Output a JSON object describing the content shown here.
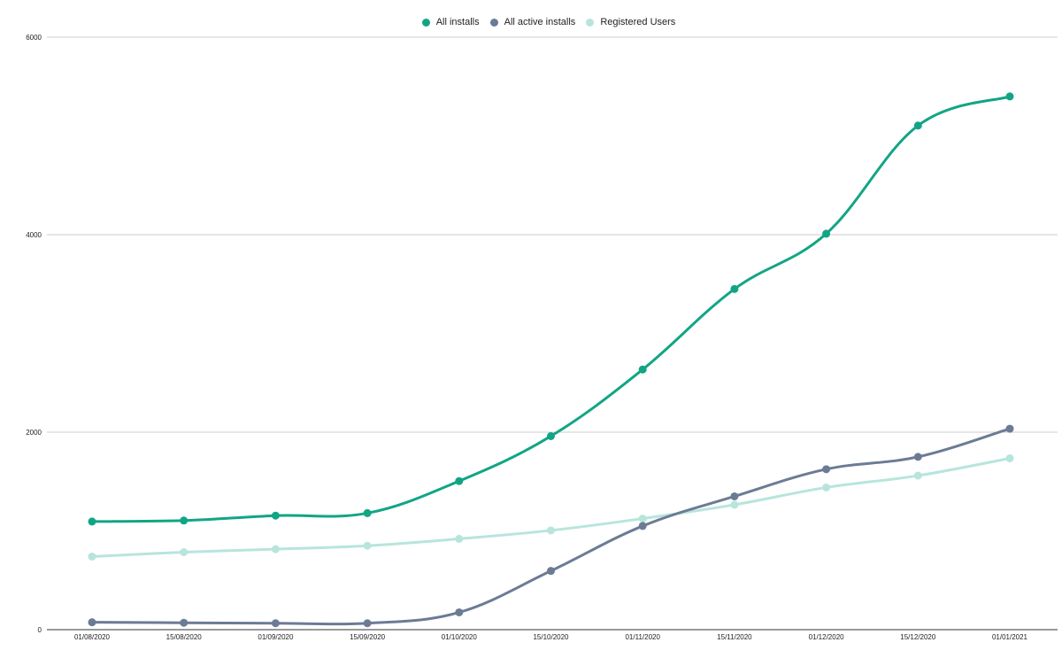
{
  "chart_data": {
    "type": "line",
    "title": "",
    "xlabel": "",
    "ylabel": "",
    "categories": [
      "01/08/2020",
      "15/08/2020",
      "01/09/2020",
      "15/09/2020",
      "01/10/2020",
      "15/10/2020",
      "01/11/2020",
      "15/11/2020",
      "01/12/2020",
      "15/12/2020",
      "01/01/2021"
    ],
    "yticks": [
      "0",
      "2000",
      "4000",
      "6000"
    ],
    "ylim": [
      0,
      6000
    ],
    "grid": true,
    "legend_position": "top-center",
    "series": [
      {
        "name": "All installs",
        "color": "#12a585",
        "values": [
          1095,
          1105,
          1155,
          1180,
          1505,
          1960,
          2635,
          3450,
          4010,
          5105,
          5400
        ]
      },
      {
        "name": "All active installs",
        "color": "#6c7b95",
        "values": [
          75,
          70,
          65,
          65,
          175,
          595,
          1050,
          1350,
          1625,
          1750,
          2035
        ]
      },
      {
        "name": "Registered Users",
        "color": "#b7e5dc",
        "values": [
          740,
          785,
          815,
          850,
          920,
          1005,
          1125,
          1265,
          1440,
          1560,
          1735
        ]
      }
    ]
  }
}
